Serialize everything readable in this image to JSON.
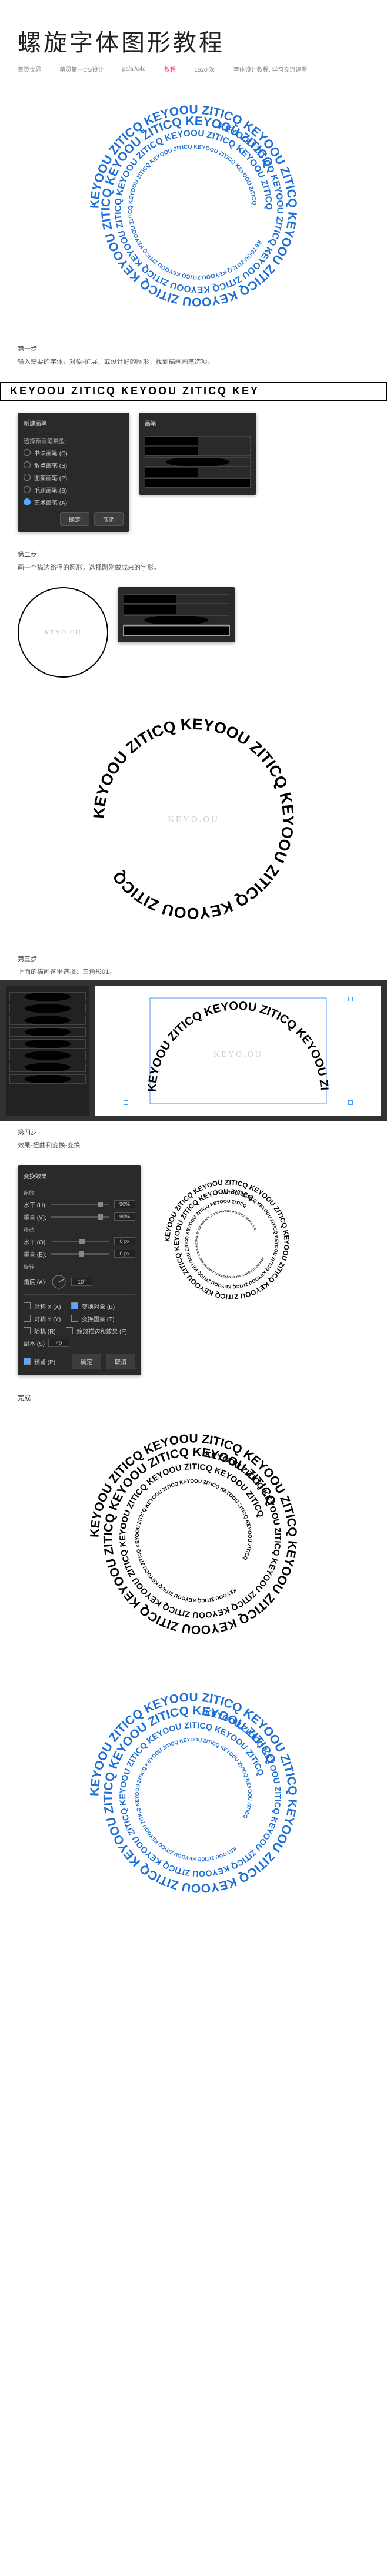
{
  "header": {
    "title": "螺旋字体图形教程",
    "crumbs": [
      "首页世界",
      "精灵第一CG设计",
      "ps/ai/c4d",
      "教程",
      "1520 次",
      "字体设计教程, 学习交流速看"
    ]
  },
  "spiral": {
    "text": "KEYOOU ZITICQ KEYOOU ZITICQ KEYOOU ZITICQ KEYOOU ZITICQ KEYOOU ZITICQ KEYOOU ZITICQ KEYOOU ZITICQ KEYOOU ZITICQ"
  },
  "step1": {
    "label": "第一步",
    "desc": "输入需要的字体，对象-扩展，或设计好的图形，找到描画画笔选项。",
    "strip_text": "KEYOOU ZITICQ KEYOOU ZITICQ KEY",
    "dialog": {
      "title": "新建画笔",
      "subtitle": "选择新画笔类型:",
      "options": [
        "书法画笔 (C)",
        "散点画笔 (S)",
        "图案画笔 (P)",
        "毛刷画笔 (B)",
        "艺术画笔 (A)"
      ],
      "selected": 4,
      "ok": "确定",
      "cancel": "取消"
    },
    "brush_panel_title": "画笔"
  },
  "step2": {
    "label": "第二步",
    "desc": "画一个描边路径的圆形，选择刚刚做成来的字形。",
    "circle_label": "KEYO.OU",
    "ring_text": "KEYOOU ZITICQ KEYOOU ZITICQ KEYOOU ZITICQ KEYOOU ZITICQ"
  },
  "step3": {
    "label": "第三步",
    "desc": "上面的描画这里选择：三角形01。"
  },
  "step4": {
    "label": "第四步",
    "desc": "效果-扭曲和变换-变换",
    "dialog": {
      "title": "变换效果",
      "sections": {
        "scale_label": "缩放",
        "horiz_label": "水平 (H):",
        "horiz_val": "90%",
        "vert_label": "垂直 (V):",
        "vert_val": "90%",
        "move_label": "移动",
        "move_h_label": "水平 (O):",
        "move_h_val": "0 px",
        "move_v_label": "垂直 (E):",
        "move_v_val": "0 px",
        "rotate_label": "旋转",
        "angle_label": "角度 (A):",
        "angle_val": "10°",
        "opts": [
          "对称 X (X)",
          "对称 Y (Y)",
          "随机 (R)"
        ],
        "reflect_x": "变换对象 (B)",
        "reflect_y": "变换图案 (T)",
        "scale_stroke": "缩放描边和效果 (F)",
        "copies_label": "副本 (S)",
        "copies_val": "40",
        "preview": "预览 (P)"
      },
      "ok": "确定",
      "cancel": "取消"
    }
  },
  "final": {
    "label": "完成"
  }
}
